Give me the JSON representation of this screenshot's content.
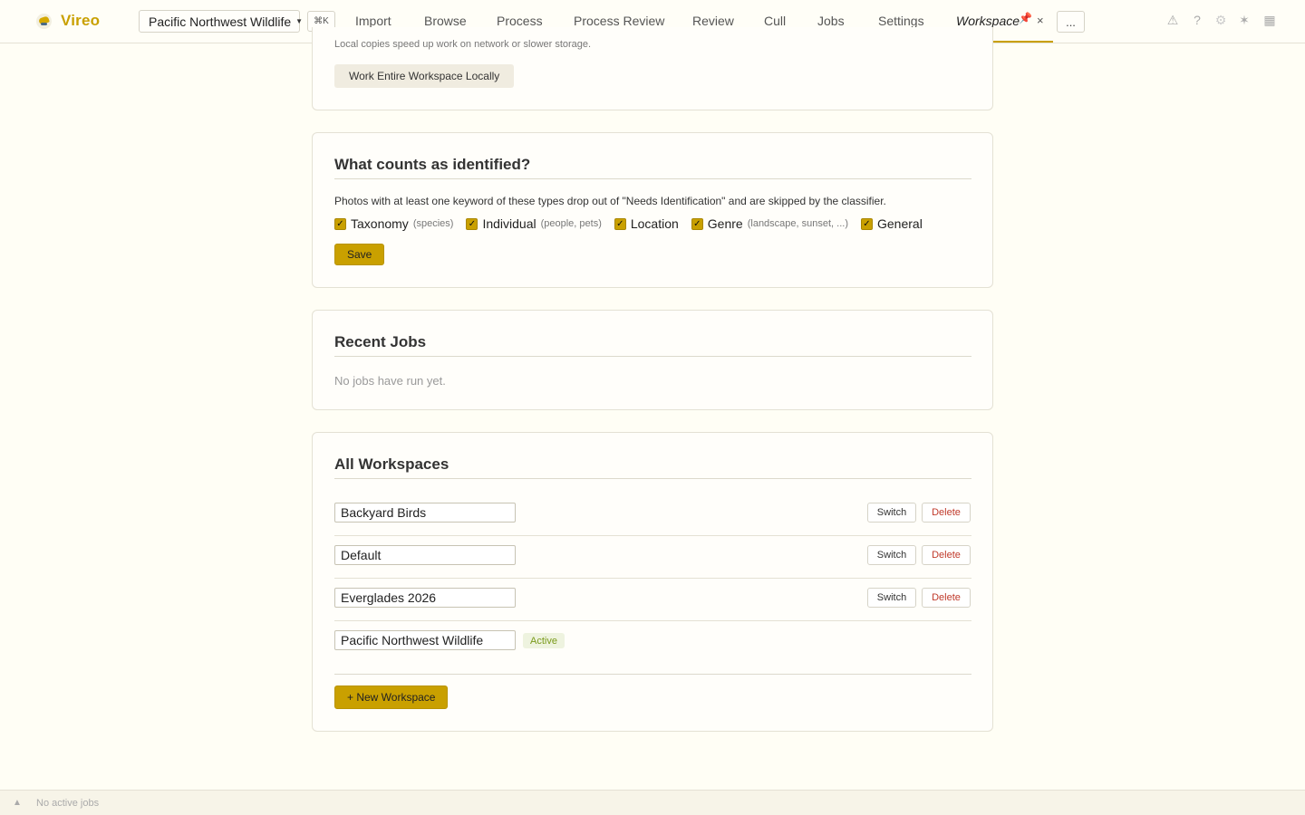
{
  "app": {
    "name": "Vireo"
  },
  "topbar": {
    "workspace_selector": "Pacific Northwest Wildlife",
    "command_shortcut": "⌘K",
    "nav": [
      "Import",
      "Browse",
      "Process",
      "Process Review",
      "Review",
      "Cull",
      "Jobs",
      "Settings"
    ],
    "active_tab": {
      "label": "Workspace",
      "pin": "📌",
      "close": "×"
    },
    "more_label": "...",
    "icons": [
      "warning-icon",
      "help-icon",
      "settings-icon",
      "theme-icon",
      "panel-icon"
    ]
  },
  "local_copy": {
    "note": "Local copies speed up work on network or slower storage.",
    "button": "Work Entire Workspace Locally"
  },
  "identified": {
    "title": "What counts as identified?",
    "description": "Photos with at least one keyword of these types drop out of \"Needs Identification\" and are skipped by the classifier.",
    "options": [
      {
        "label": "Taxonomy",
        "hint": "(species)",
        "checked": true
      },
      {
        "label": "Individual",
        "hint": "(people, pets)",
        "checked": true
      },
      {
        "label": "Location",
        "hint": "",
        "checked": true
      },
      {
        "label": "Genre",
        "hint": "(landscape, sunset, ...)",
        "checked": true
      },
      {
        "label": "General",
        "hint": "",
        "checked": true
      }
    ],
    "save_label": "Save"
  },
  "recent_jobs": {
    "title": "Recent Jobs",
    "empty": "No jobs have run yet."
  },
  "all_workspaces": {
    "title": "All Workspaces",
    "switch_label": "Switch",
    "delete_label": "Delete",
    "active_label": "Active",
    "workspaces": [
      {
        "name": "Backyard Birds",
        "active": false
      },
      {
        "name": "Default",
        "active": false
      },
      {
        "name": "Everglades 2026",
        "active": false
      },
      {
        "name": "Pacific Northwest Wildlife",
        "active": true
      }
    ],
    "new_label": "+ New Workspace"
  },
  "statusbar": {
    "indicator": "▲",
    "text": "No active jobs"
  },
  "colors": {
    "accent": "#c9a000",
    "background": "#fffef5",
    "danger": "#c03a2b",
    "active_badge": "#7a9a1a"
  }
}
